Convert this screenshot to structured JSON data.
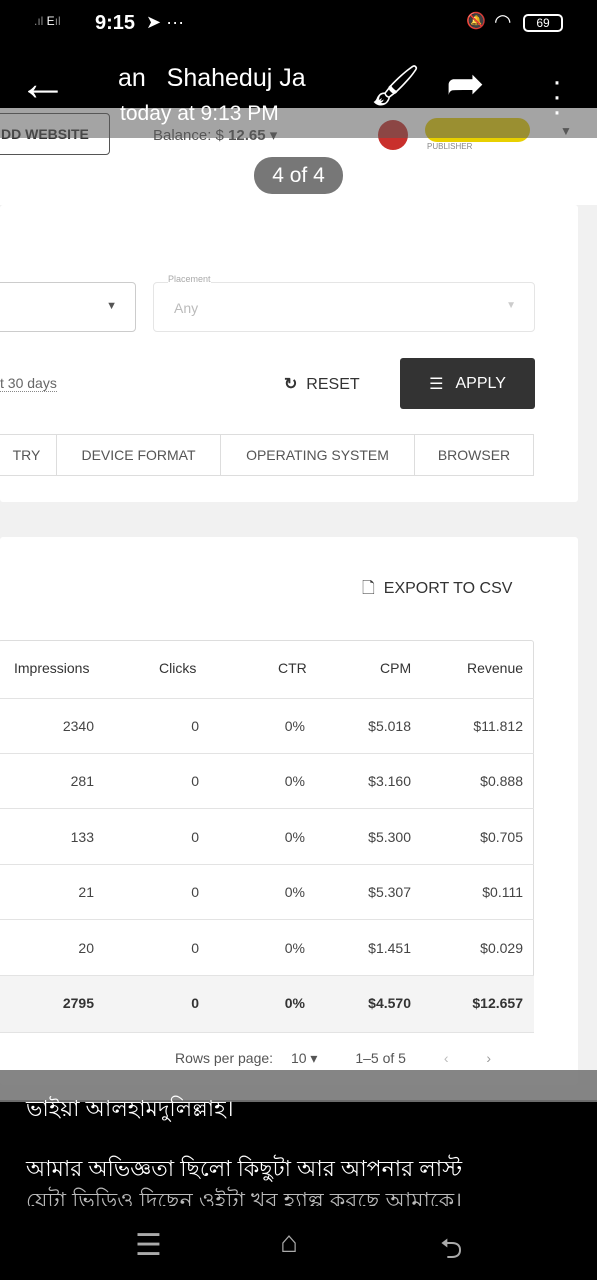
{
  "status_bar": {
    "time": "9:15",
    "battery": "69",
    "network": "E"
  },
  "viewer": {
    "sender": "an   Shaheduj Ja",
    "timestamp": "today at 9:13 PM",
    "counter": "4 of 4"
  },
  "site_header": {
    "add_website": "DD WEBSITE",
    "balance_label": "Balance:  $",
    "balance_value": "12.65",
    "role": "PUBLISHER"
  },
  "filters": {
    "placement_label": "Placement",
    "placement_value": "Any",
    "date_range": "t 30 days",
    "reset": "RESET",
    "apply": "APPLY",
    "tabs": [
      "TRY",
      "DEVICE FORMAT",
      "OPERATING SYSTEM",
      "BROWSER"
    ]
  },
  "report": {
    "export": "EXPORT TO CSV",
    "columns": [
      "Impressions",
      "Clicks",
      "CTR",
      "CPM",
      "Revenue"
    ],
    "rows": [
      [
        "2340",
        "0",
        "0%",
        "$5.018",
        "$11.812"
      ],
      [
        "281",
        "0",
        "0%",
        "$3.160",
        "$0.888"
      ],
      [
        "133",
        "0",
        "0%",
        "$5.300",
        "$0.705"
      ],
      [
        "21",
        "0",
        "0%",
        "$5.307",
        "$0.111"
      ],
      [
        "20",
        "0",
        "0%",
        "$1.451",
        "$0.029"
      ]
    ],
    "total": [
      "2795",
      "0",
      "0%",
      "$4.570",
      "$12.657"
    ],
    "rows_per_page_label": "Rows per page:",
    "rows_per_page": "10",
    "range": "1–5 of 5"
  },
  "caption": {
    "line1": "ভাইয়া আলহামদুলিল্লাহ।",
    "line2": "আমার অভিজ্ঞতা ছিলো কিছুটা আর আপনার লাস্ট",
    "line3": "যেটা ভিডিও দিছেন ওইটা খুব হ্যাল্প করছে আমাকে।"
  }
}
